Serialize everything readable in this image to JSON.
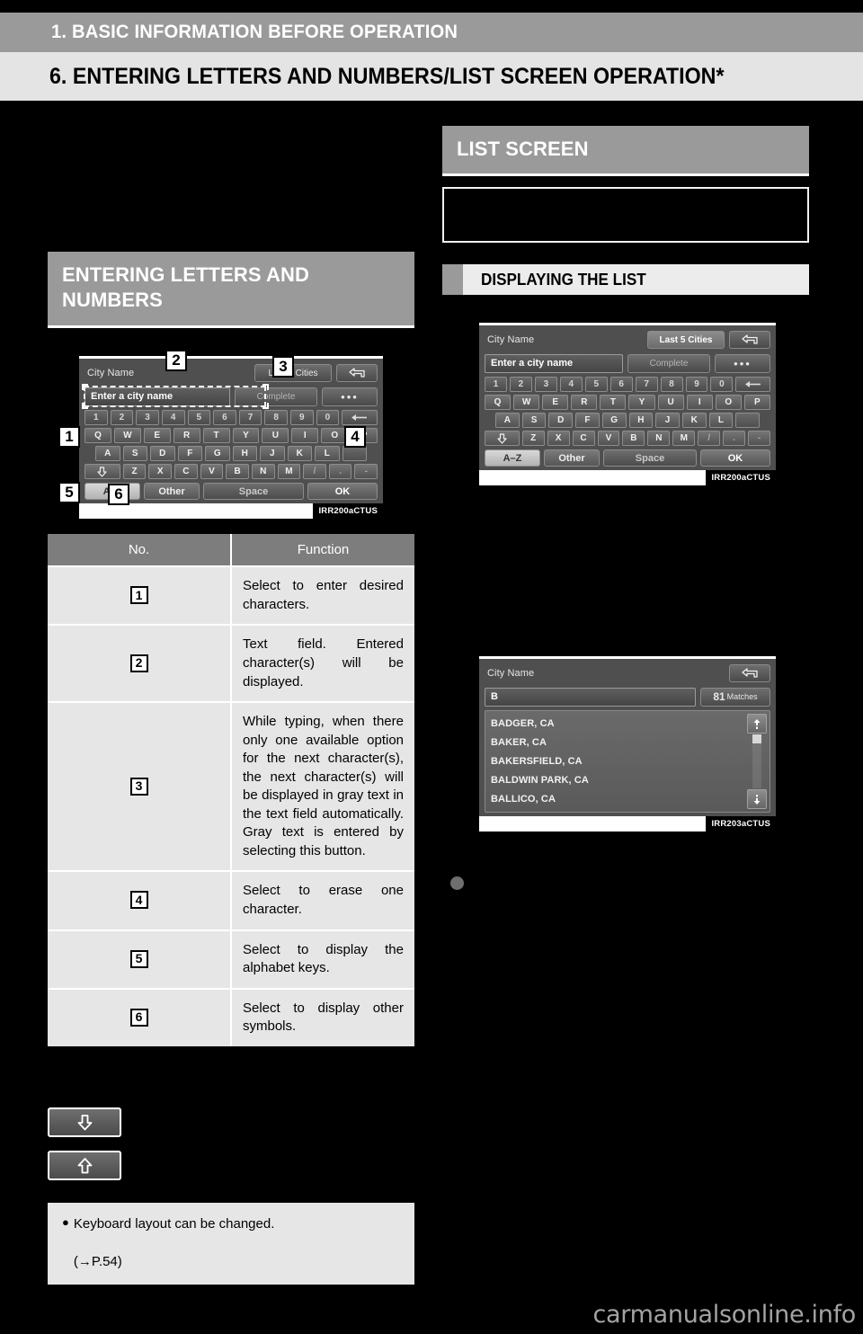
{
  "header": {
    "chapter": "1. BASIC INFORMATION BEFORE OPERATION",
    "section": "6. ENTERING LETTERS AND NUMBERS/LIST SCREEN OPERATION*"
  },
  "left_column": {
    "heading": "ENTERING LETTERS AND NUMBERS",
    "keyboard_screen": {
      "title": "City Name",
      "last_cities_button": "Last 5 Cities",
      "back_icon": "back-arrow-icon",
      "text_field_value": "Enter a city name",
      "complete_button": "Complete",
      "more_button": "•••",
      "number_row": [
        "1",
        "2",
        "3",
        "4",
        "5",
        "6",
        "7",
        "8",
        "9",
        "0"
      ],
      "backspace_icon": "backspace-arrow-icon",
      "row_q": [
        "Q",
        "W",
        "E",
        "R",
        "T",
        "Y",
        "U",
        "I",
        "O",
        "P"
      ],
      "row_a": [
        "A",
        "S",
        "D",
        "F",
        "G",
        "H",
        "J",
        "K",
        "L"
      ],
      "shift_icon": "shift-down-arrow-icon",
      "row_z": [
        "Z",
        "X",
        "C",
        "V",
        "B",
        "N",
        "M",
        "/",
        ".",
        "-"
      ],
      "az_button": "A–Z",
      "other_button": "Other",
      "space_button": "Space",
      "ok_button": "OK",
      "image_id": "IRR200aCTUS"
    },
    "callouts": [
      "1",
      "2",
      "3",
      "4",
      "5",
      "6"
    ],
    "table": {
      "columns": [
        "No.",
        "Function"
      ],
      "rows": [
        {
          "no": "1",
          "function": "Select to enter desired characters."
        },
        {
          "no": "2",
          "function": "Text field. Entered character(s) will be displayed."
        },
        {
          "no": "3",
          "function": "While typing, when there only one available option for the next character(s), the next character(s) will be displayed in gray text in the text field automatically. Gray text is entered by selecting this button."
        },
        {
          "no": "4",
          "function": "Select to erase one character."
        },
        {
          "no": "5",
          "function": "Select to display the alphabet keys."
        },
        {
          "no": "6",
          "function": "Select to display other symbols."
        }
      ]
    },
    "key_swatches": [
      {
        "icon": "down-arrow-key-icon",
        "glyph": "⇩"
      },
      {
        "icon": "up-arrow-key-icon",
        "glyph": "⇧"
      }
    ],
    "note": {
      "bullet": "●",
      "line1": "Keyboard layout can be changed.",
      "line2": "(→P.54)"
    }
  },
  "right_column": {
    "heading": "LIST SCREEN",
    "subheading": "DISPLAYING THE LIST",
    "keyboard_screen": {
      "title": "City Name",
      "last_cities_button": "Last 5 Cities",
      "back_icon": "back-arrow-icon",
      "text_field_value": "Enter a city name",
      "complete_button": "Complete",
      "more_button": "•••",
      "number_row": [
        "1",
        "2",
        "3",
        "4",
        "5",
        "6",
        "7",
        "8",
        "9",
        "0"
      ],
      "backspace_icon": "backspace-arrow-icon",
      "row_q": [
        "Q",
        "W",
        "E",
        "R",
        "T",
        "Y",
        "U",
        "I",
        "O",
        "P"
      ],
      "row_a": [
        "A",
        "S",
        "D",
        "F",
        "G",
        "H",
        "J",
        "K",
        "L"
      ],
      "shift_icon": "shift-down-arrow-icon",
      "shift_glyph": "⇩",
      "row_z": [
        "Z",
        "X",
        "C",
        "V",
        "B",
        "N",
        "M",
        "/",
        ".",
        "-"
      ],
      "az_button": "A–Z",
      "other_button": "Other",
      "space_button": "Space",
      "ok_button": "OK",
      "image_id": "IRR200aCTUS"
    },
    "list_screen": {
      "title": "City Name",
      "back_icon": "back-arrow-icon",
      "query_value": "B",
      "matches_count": "81",
      "matches_label": "Matches",
      "items": [
        "BADGER, CA",
        "BAKER, CA",
        "BAKERSFIELD, CA",
        "BALDWIN PARK, CA",
        "BALLICO, CA"
      ],
      "scroll_up_icon": "scroll-up-icon",
      "scroll_down_icon": "scroll-down-icon",
      "image_id": "IRR203aCTUS"
    }
  },
  "footer": {
    "watermark": "carmanualsonline.info"
  }
}
